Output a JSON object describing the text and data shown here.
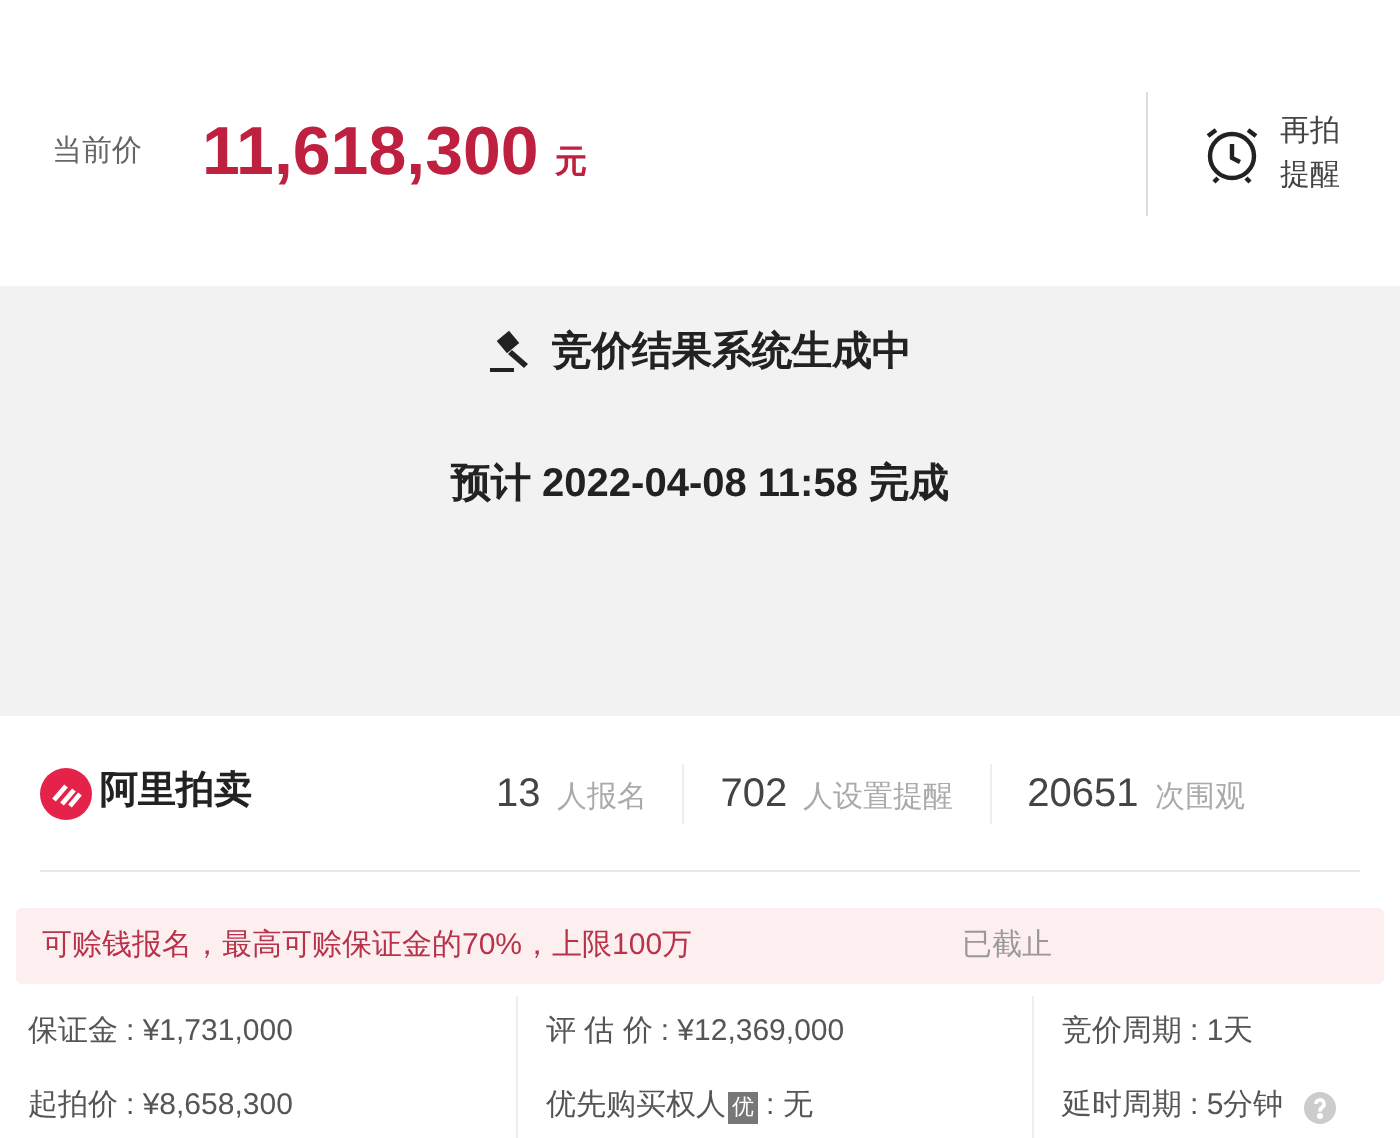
{
  "price": {
    "label": "当前价",
    "value": "11,618,300",
    "unit": "元"
  },
  "reminder": {
    "label_line1": "再拍",
    "label_line2": "提醒"
  },
  "status": {
    "title": "竞价结果系统生成中",
    "eta": "预计 2022-04-08 11:58 完成"
  },
  "brand": "阿里拍卖",
  "stats": [
    {
      "count": "13",
      "label": "人报名"
    },
    {
      "count": "702",
      "label": "人设置提醒"
    },
    {
      "count": "20651",
      "label": "次围观"
    }
  ],
  "notice": {
    "text": "可赊钱报名，最高可赊保证金的70%，上限100万",
    "status": "已截止"
  },
  "details": [
    {
      "label": "保证金",
      "value": ": ¥1,731,000"
    },
    {
      "label": "评 估 价",
      "value": ": ¥12,369,000"
    },
    {
      "label": "竞价周期",
      "value": ": 1天"
    },
    {
      "label": "起拍价",
      "value": ": ¥8,658,300"
    },
    {
      "label": "优先购买权人",
      "badge": "优",
      "value": ": 无"
    },
    {
      "label": "延时周期",
      "value": ": 5分钟",
      "help": true
    }
  ]
}
